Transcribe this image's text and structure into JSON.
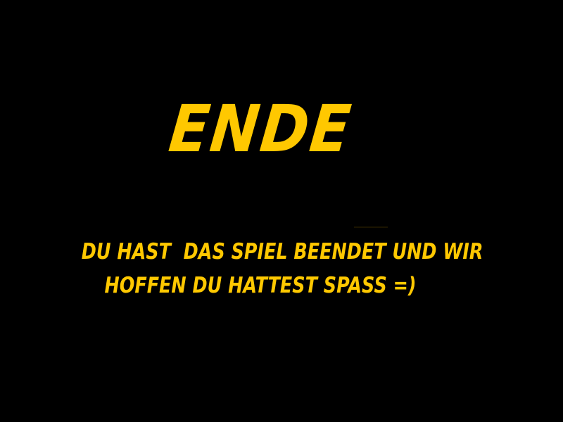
{
  "screen": {
    "title": "ENDE",
    "message_line1": "DU HAST  DAS SPIEL BEENDET UND WIR",
    "message_line2": "HOFFEN DU HATTEST SPASS =)"
  },
  "colors": {
    "background": "#000000",
    "text": "#FFC800"
  }
}
